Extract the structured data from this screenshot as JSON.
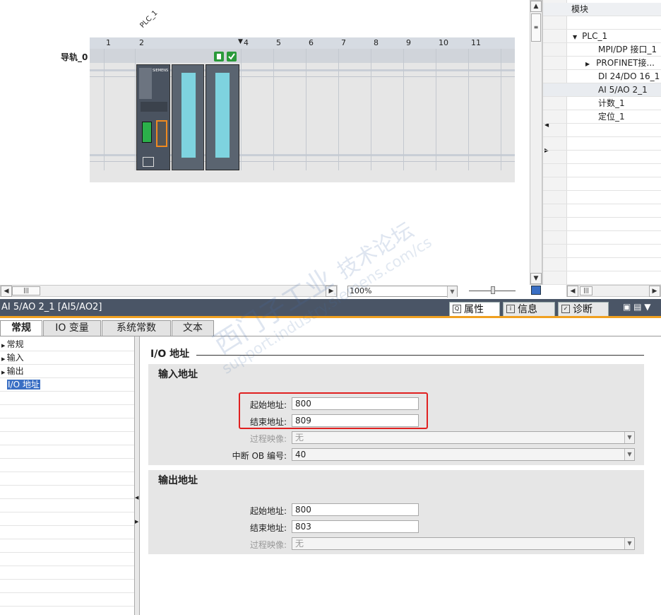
{
  "device_view": {
    "plc_name": "PLC_1",
    "rail_label": "导轨_0",
    "slots": [
      "1",
      "2",
      "4",
      "5",
      "6",
      "7",
      "8",
      "9",
      "10",
      "11"
    ],
    "zoom": "100%",
    "cpu_brand": "SIEMENS"
  },
  "module_panel": {
    "header": "模块",
    "items": [
      {
        "label": "PLC_1",
        "indent": 0,
        "expander": "down"
      },
      {
        "label": "MPI/DP 接口_1",
        "indent": 2,
        "expander": ""
      },
      {
        "label": "PROFINET接...",
        "indent": 1,
        "expander": "right"
      },
      {
        "label": "DI 24/DO 16_1",
        "indent": 2,
        "expander": ""
      },
      {
        "label": "AI 5/AO 2_1",
        "indent": 2,
        "expander": ""
      },
      {
        "label": "计数_1",
        "indent": 2,
        "expander": ""
      },
      {
        "label": "定位_1",
        "indent": 2,
        "expander": ""
      }
    ]
  },
  "inspector": {
    "title": "AI 5/AO 2_1 [AI5/AO2]",
    "top_tabs": [
      {
        "label": "属性",
        "icon": "properties-icon",
        "active": true
      },
      {
        "label": "信息",
        "icon": "info-icon",
        "active": false
      },
      {
        "label": "诊断",
        "icon": "diagnostics-icon",
        "active": false
      }
    ],
    "sub_tabs": [
      "常规",
      "IO 变量",
      "系统常数",
      "文本"
    ],
    "nav": [
      "常规",
      "输入",
      "输出",
      "I/O 地址"
    ],
    "page_title": "I/O 地址",
    "input_section": {
      "title": "输入地址",
      "start_label": "起始地址:",
      "start_value": "800",
      "end_label": "结束地址:",
      "end_value": "809",
      "process_image_label": "过程映像:",
      "process_image_value": "无",
      "interrupt_ob_label": "中断 OB 编号:",
      "interrupt_ob_value": "40"
    },
    "output_section": {
      "title": "输出地址",
      "start_label": "起始地址:",
      "start_value": "800",
      "end_label": "结束地址:",
      "end_value": "803",
      "process_image_label": "过程映像:",
      "process_image_value": "无"
    }
  },
  "watermark": {
    "line1": "西门子工业",
    "line2": "技术论坛",
    "line3": "support.industry.siemens.com/cs"
  },
  "colors": {
    "title_bar": "#4a5566",
    "accent_orange": "#f0a020",
    "highlight_red": "#e02020",
    "selected_blue": "#3a6fc4",
    "module_green": "#2a9a3a"
  }
}
